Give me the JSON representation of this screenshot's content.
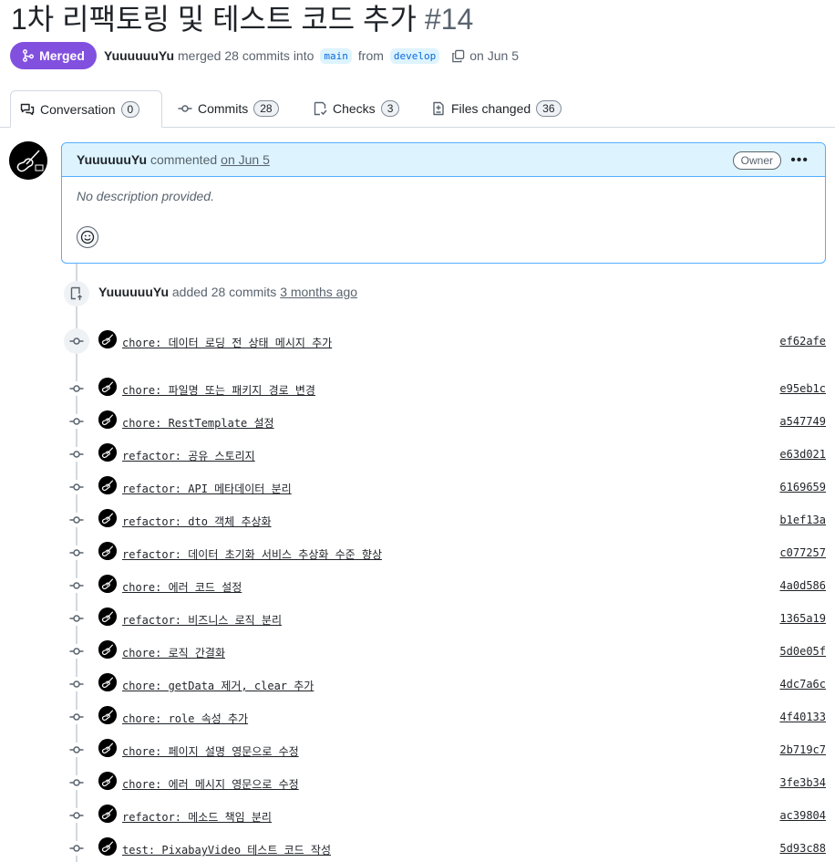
{
  "pr": {
    "title": "1차 리팩토링 및 테스트 코드 추가",
    "number": "#14",
    "status": "Merged",
    "author": "YuuuuuuYu",
    "merge_text": "merged 28 commits into",
    "base_branch": "main",
    "from_text": "from",
    "head_branch": "develop",
    "date_text": "on Jun 5"
  },
  "tabs": [
    {
      "label": "Conversation",
      "count": "0"
    },
    {
      "label": "Commits",
      "count": "28"
    },
    {
      "label": "Checks",
      "count": "3"
    },
    {
      "label": "Files changed",
      "count": "36"
    }
  ],
  "comment": {
    "author": "YuuuuuuYu",
    "action": "commented",
    "date": "on Jun 5",
    "role": "Owner",
    "body": "No description provided."
  },
  "timeline_event": {
    "author": "YuuuuuuYu",
    "action": "added 28 commits",
    "ago": "3 months ago"
  },
  "commits": [
    {
      "message": "chore: 데이터 로딩 전 상태 메시지 추가",
      "sha": "ef62afe"
    },
    {
      "message": "chore: 파일명 또는 패키지 경로 변경",
      "sha": "e95eb1c"
    },
    {
      "message": "chore: RestTemplate 설정",
      "sha": "a547749"
    },
    {
      "message": "refactor: 공유 스토리지",
      "sha": "e63d021"
    },
    {
      "message": "refactor: API 메타데이터 분리",
      "sha": "6169659"
    },
    {
      "message": "refactor: dto 객체 추상화",
      "sha": "b1ef13a"
    },
    {
      "message": "refactor: 데이터 초기화 서비스 추상화 수준 향상",
      "sha": "c077257"
    },
    {
      "message": "chore: 에러 코드 설정",
      "sha": "4a0d586"
    },
    {
      "message": "refactor: 비즈니스 로직 분리",
      "sha": "1365a19"
    },
    {
      "message": "chore: 로직 간결화",
      "sha": "5d0e05f"
    },
    {
      "message": "chore: getData 제거, clear 추가",
      "sha": "4dc7a6c"
    },
    {
      "message": "chore: role 속성 추가",
      "sha": "4f40133"
    },
    {
      "message": "chore: 페이지 설명 영문으로 수정",
      "sha": "2b719c7"
    },
    {
      "message": "chore: 에러 메시지 영문으로 수정",
      "sha": "3fe3b34"
    },
    {
      "message": "refactor: 메소드 책임 분리",
      "sha": "ac39804"
    },
    {
      "message": "test: PixabayVideo 테스트 코드 작성",
      "sha": "5d93c88"
    }
  ]
}
